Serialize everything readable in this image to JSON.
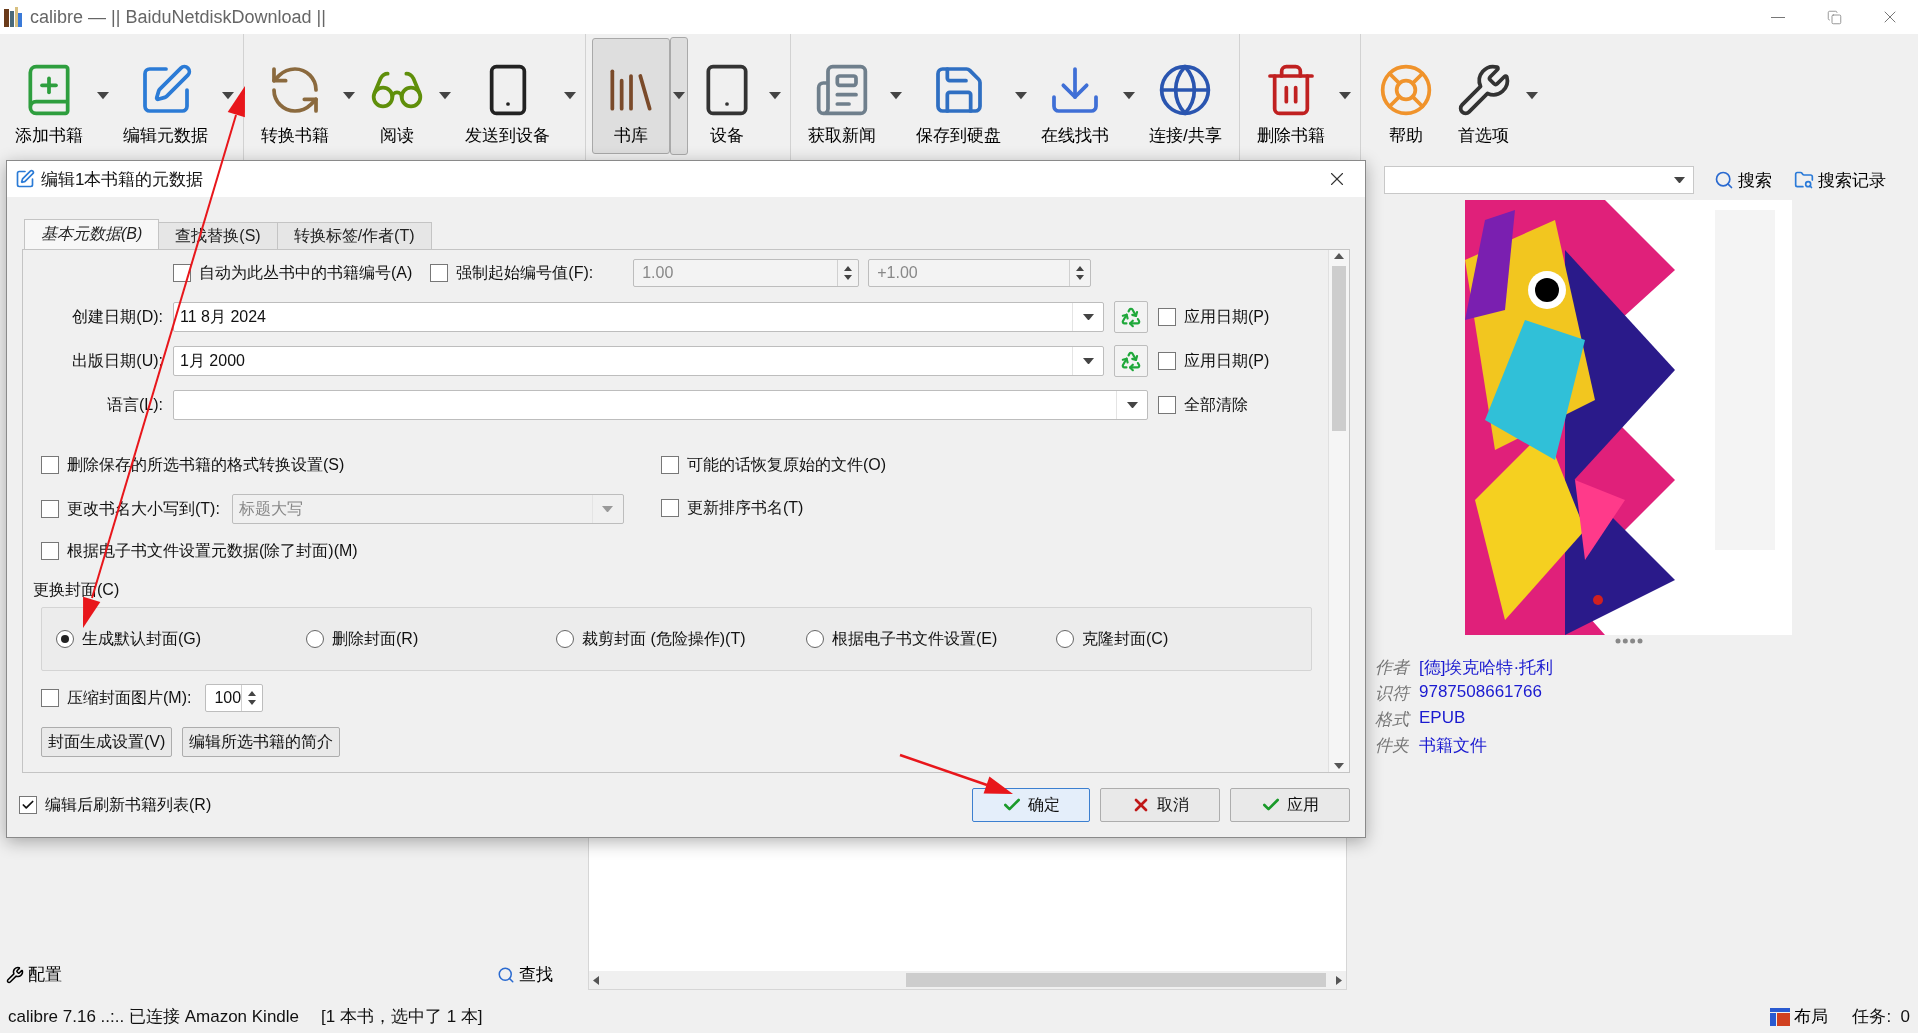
{
  "window": {
    "title": "calibre — || BaiduNetdiskDownload ||"
  },
  "toolbar": {
    "groups": [
      [
        {
          "label": "添加书籍",
          "dropdown": true,
          "selected": false
        },
        {
          "label": "编辑元数据",
          "dropdown": true,
          "selected": false
        }
      ],
      [
        {
          "label": "转换书籍",
          "dropdown": true,
          "selected": false
        },
        {
          "label": "阅读",
          "dropdown": true,
          "selected": false
        },
        {
          "label": "发送到设备",
          "dropdown": true,
          "selected": false
        }
      ],
      [
        {
          "label": "书库",
          "dropdown": true,
          "selected": true
        },
        {
          "label": "设备",
          "dropdown": true,
          "selected": false
        }
      ],
      [
        {
          "label": "获取新闻",
          "dropdown": true,
          "selected": false
        },
        {
          "label": "保存到硬盘",
          "dropdown": true,
          "selected": false
        },
        {
          "label": "在线找书",
          "dropdown": true,
          "selected": false
        },
        {
          "label": "连接/共享",
          "dropdown": false,
          "selected": false
        }
      ],
      [
        {
          "label": "删除书籍",
          "dropdown": true,
          "selected": false
        }
      ],
      [
        {
          "label": "帮助",
          "dropdown": false,
          "selected": false
        },
        {
          "label": "首选项",
          "dropdown": true,
          "selected": false
        }
      ]
    ]
  },
  "search": {
    "buttons": [
      "搜索",
      "搜索记录"
    ]
  },
  "left_panel": {
    "configure_button": "配置",
    "find_button": "查找"
  },
  "book_details": {
    "fields": [
      {
        "label": "作者",
        "value": "[德]埃克哈特·托利"
      },
      {
        "label": "识符",
        "value": "9787508661766"
      },
      {
        "label": "格式",
        "value": "EPUB"
      },
      {
        "label": "件夹",
        "value": "书籍文件"
      }
    ]
  },
  "status_bar": {
    "left": "calibre 7.16 ..:.. 已连接 Amazon Kindle",
    "selection": "[1 本书，选中了 1 本]",
    "layout_button": "布局",
    "tasks": "任务:  0"
  },
  "dialog": {
    "title": "编辑1本书籍的元数据",
    "tabs": [
      {
        "label": "基本元数据(B)",
        "selected": true
      },
      {
        "label": "查找替换(S)",
        "selected": false
      },
      {
        "label": "转换标签/作者(T)",
        "selected": false
      }
    ],
    "series": {
      "auto_number": {
        "label": "自动为此丛书中的书籍编号(A)",
        "checked": false
      },
      "force_start": {
        "label": "强制起始编号值(F):",
        "checked": false
      },
      "start_value": {
        "value": "1.00",
        "disabled": true
      },
      "increment": {
        "value": "+1.00",
        "disabled": true
      }
    },
    "dates": [
      {
        "label": "创建日期(D):",
        "value": "11 8月 2024",
        "apply_label": "应用日期(P)",
        "apply_checked": false
      },
      {
        "label": "出版日期(U):",
        "value": "1月 2000",
        "apply_label": "应用日期(P)",
        "apply_checked": false
      }
    ],
    "language": {
      "label": "语言(L):",
      "clear_label": "全部清除",
      "clear_checked": false
    },
    "options": [
      {
        "kind": "checkbox",
        "label": "删除保存的所选书籍的格式转换设置(S)",
        "checked": false
      },
      {
        "kind": "checkbox",
        "label": "可能的话恢复原始的文件(O)",
        "checked": false
      },
      {
        "kind": "case_combo",
        "label": "更改书名大小写到(T):",
        "checked": false,
        "value": "标题大写",
        "disabled": true
      },
      {
        "kind": "checkbox",
        "label": "更新排序书名(T)",
        "checked": false
      },
      {
        "kind": "checkbox",
        "label": "根据电子书文件设置元数据(除了封面)(M)",
        "checked": false
      }
    ],
    "cover": {
      "label": "更换封面(C)",
      "options": [
        {
          "label": "生成默认封面(G)",
          "selected": true
        },
        {
          "label": "删除封面(R)",
          "selected": false
        },
        {
          "label": "裁剪封面 (危险操作)(T)",
          "selected": false
        },
        {
          "label": "根据电子书文件设置(E)",
          "selected": false
        },
        {
          "label": "克隆封面(C)",
          "selected": false
        }
      ]
    },
    "compress": {
      "label": "压缩封面图片(M):",
      "checked": false,
      "value": "100"
    },
    "buttons": [
      "封面生成设置(V)",
      "编辑所选书籍的简介"
    ],
    "refresh": {
      "label": "编辑后刷新书籍列表(R)",
      "checked": true
    },
    "actions": [
      {
        "label": "确定",
        "kind": "ok"
      },
      {
        "label": "取消",
        "kind": "cancel"
      },
      {
        "label": "应用",
        "kind": "apply"
      }
    ]
  }
}
